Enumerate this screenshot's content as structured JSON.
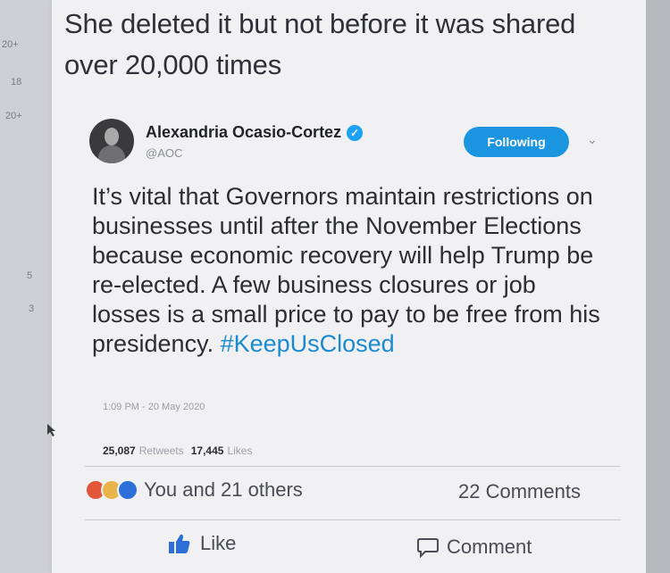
{
  "left_margin": {
    "numbers": [
      "20+",
      "18",
      "20+",
      "5",
      "3"
    ]
  },
  "post": {
    "text": "She deleted it but not before it was shared over 20,000 times"
  },
  "tweet": {
    "display_name": "Alexandria Ocasio-Cortez",
    "handle": "@AOC",
    "follow_label": "Following",
    "body_text": "It’s vital that Governors maintain restrictions on businesses until after the November Elections because economic recovery will help Trump be re-elected. A few business closures or job losses is a small price to pay to be free from his presidency. ",
    "hashtag": "#KeepUsClosed",
    "timestamp": "1:09 PM - 20 May 2020",
    "retweets_count": "25,087",
    "retweets_label": "Retweets",
    "likes_count": "17,445",
    "likes_label": "Likes",
    "verified_icon": "verified-badge-icon",
    "accent_color": "#1b95e0"
  },
  "engagement": {
    "reactions_text": "You and 21 others",
    "comments_text": "22 Comments",
    "like_label": "Like",
    "comment_label": "Comment"
  }
}
